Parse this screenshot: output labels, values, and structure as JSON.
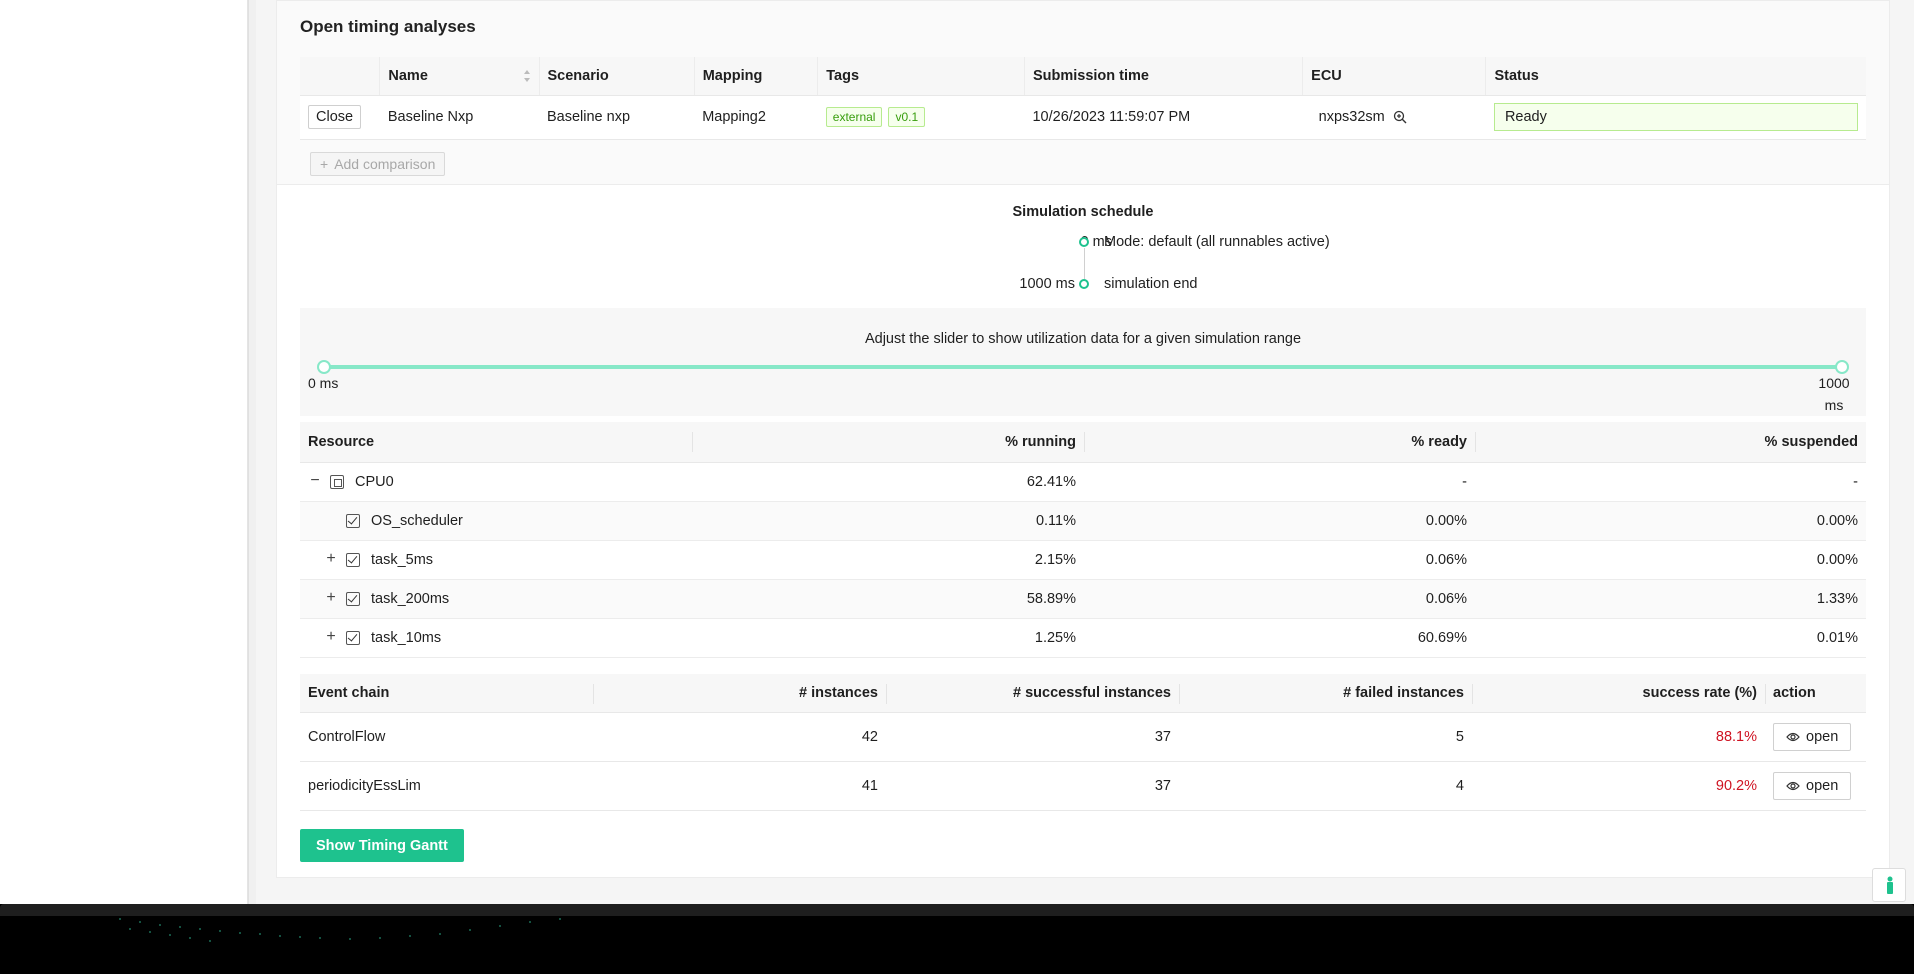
{
  "section_title": "Open timing analyses",
  "analyses": {
    "headers": [
      "Name",
      "Scenario",
      "Mapping",
      "Tags",
      "Submission time",
      "ECU",
      "Status"
    ],
    "rows": [
      {
        "close_label": "Close",
        "name": "Baseline Nxp",
        "scenario": "Baseline nxp",
        "mapping": "Mapping2",
        "tags": [
          "external",
          "v0.1"
        ],
        "submission_time": "10/26/2023 11:59:07 PM",
        "ecu": "nxps32sm",
        "status": "Ready"
      }
    ],
    "add_comparison_label": "Add comparison"
  },
  "schedule": {
    "title": "Simulation schedule",
    "items": [
      {
        "time": "0 ms",
        "label": "Mode: default (all runnables active)"
      },
      {
        "time": "1000 ms",
        "label": "simulation end"
      }
    ]
  },
  "slider": {
    "title": "Adjust the slider to show utilization data for a given simulation range",
    "min_label": "0 ms",
    "max_label_line1": "1000",
    "max_label_line2": "ms",
    "range_start_fraction": 0.0,
    "range_end_fraction": 1.0
  },
  "resources": {
    "headers": [
      "Resource",
      "% running",
      "% ready",
      "% suspended"
    ],
    "rows": [
      {
        "name": "CPU0",
        "running": "62.41%",
        "ready": "-",
        "suspended": "-"
      },
      {
        "name": "OS_scheduler",
        "running": "0.11%",
        "ready": "0.00%",
        "suspended": "0.00%"
      },
      {
        "name": "task_5ms",
        "running": "2.15%",
        "ready": "0.06%",
        "suspended": "0.00%"
      },
      {
        "name": "task_200ms",
        "running": "58.89%",
        "ready": "0.06%",
        "suspended": "1.33%"
      },
      {
        "name": "task_10ms",
        "running": "1.25%",
        "ready": "60.69%",
        "suspended": "0.01%"
      }
    ]
  },
  "event_chains": {
    "headers": [
      "Event chain",
      "# instances",
      "# successful instances",
      "# failed instances",
      "success rate (%)",
      "action"
    ],
    "rows": [
      {
        "name": "ControlFlow",
        "instances": "42",
        "successful": "37",
        "failed": "5",
        "rate": "88.1%",
        "action": "open"
      },
      {
        "name": "periodicityEssLim",
        "instances": "41",
        "successful": "37",
        "failed": "4",
        "rate": "90.2%",
        "action": "open"
      }
    ]
  },
  "gantt_button_label": "Show Timing Gantt",
  "colors": {
    "accent": "#1ec28e",
    "fail_rate": "#cf1322",
    "tag_green": "#389e0d"
  }
}
